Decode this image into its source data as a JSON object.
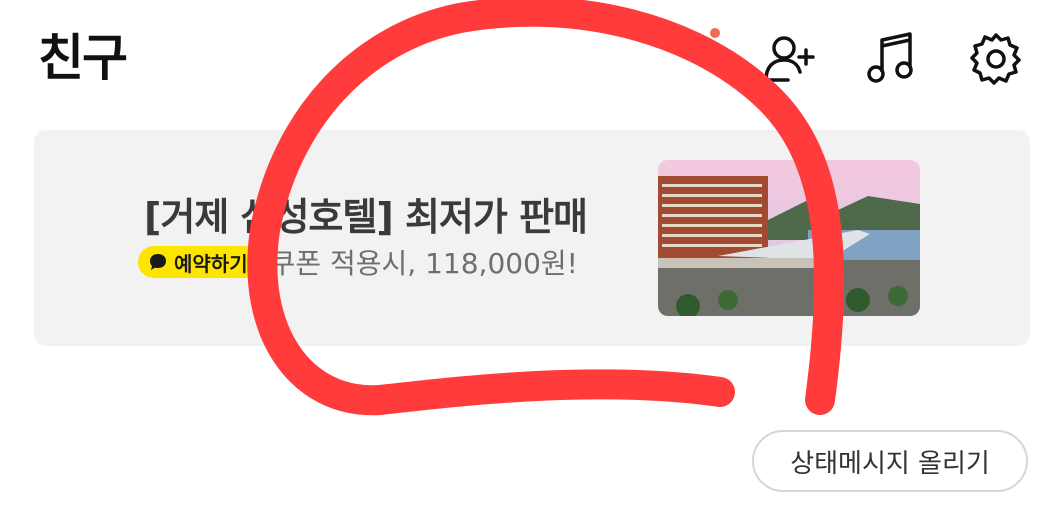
{
  "header": {
    "title": "친구",
    "icons": [
      "add-friend-icon",
      "music-icon",
      "settings-gear-icon"
    ],
    "notification_dot_color": "#f26b4f"
  },
  "banner": {
    "title": "[거제 삼성호텔] 최저가 판매",
    "badge_label": "예약하기",
    "subtitle": "쿠폰 적용시, 118,000원!",
    "image": "hotel-photo",
    "badge_color": "#fee500"
  },
  "status_button": {
    "label": "상태메시지 올리기"
  },
  "annotation": {
    "type": "red-circle-marker",
    "color": "#ff3b3b"
  }
}
